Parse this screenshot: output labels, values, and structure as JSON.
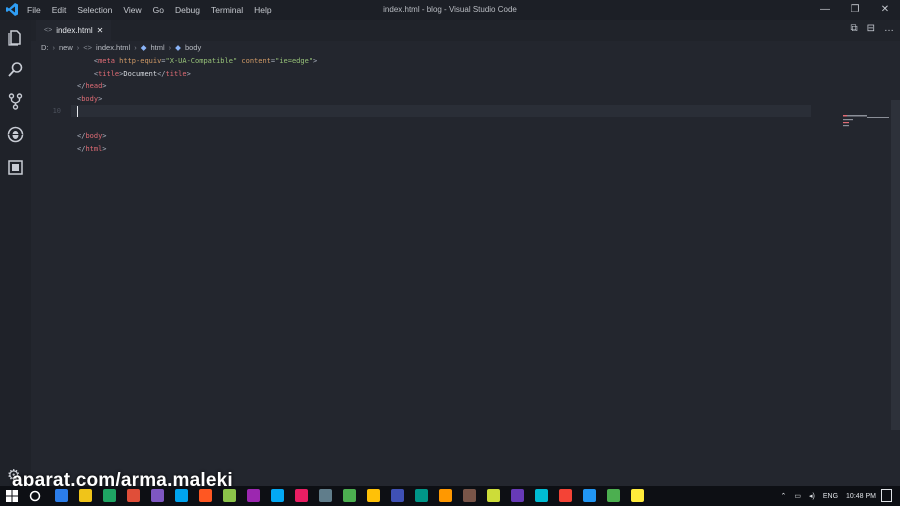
{
  "window": {
    "title": "index.html - blog - Visual Studio Code",
    "controls": [
      "—",
      "❐",
      "✕"
    ]
  },
  "menu": [
    "File",
    "Edit",
    "Selection",
    "View",
    "Go",
    "Debug",
    "Terminal",
    "Help"
  ],
  "activity_bar": [
    "files-icon",
    "search-icon",
    "source-control-icon",
    "debug-icon",
    "extensions-icon"
  ],
  "tab": {
    "label": "index.html",
    "close": "✕"
  },
  "tab_actions": [
    "⧉",
    "⊟",
    "…"
  ],
  "breadcrumb": [
    "D:",
    "new",
    "index.html",
    "html",
    "body"
  ],
  "editor": {
    "lines": [
      {
        "num": "",
        "indent": "    ",
        "tokens": [
          [
            "punct",
            "<"
          ],
          [
            "tag",
            "meta"
          ],
          [
            "attr",
            " http-equiv"
          ],
          [
            "punct",
            "="
          ],
          [
            "str",
            "\"X-UA-Compatible\""
          ],
          [
            "attr",
            " content"
          ],
          [
            "punct",
            "="
          ],
          [
            "str",
            "\"ie=edge\""
          ],
          [
            "punct",
            ">"
          ]
        ]
      },
      {
        "num": "",
        "indent": "    ",
        "tokens": [
          [
            "punct",
            "<"
          ],
          [
            "tag",
            "title"
          ],
          [
            "punct",
            ">"
          ],
          [
            "txt",
            "Document"
          ],
          [
            "punct",
            "</"
          ],
          [
            "tag",
            "title"
          ],
          [
            "punct",
            ">"
          ]
        ]
      },
      {
        "num": "",
        "indent": "",
        "tokens": [
          [
            "punct",
            "</"
          ],
          [
            "tag",
            "head"
          ],
          [
            "punct",
            ">"
          ]
        ]
      },
      {
        "num": "",
        "indent": "",
        "tokens": [
          [
            "punct",
            "<"
          ],
          [
            "tag",
            "body"
          ],
          [
            "punct",
            ">"
          ]
        ]
      },
      {
        "num": "10",
        "indent": "",
        "tokens": []
      },
      {
        "num": "",
        "indent": "",
        "tokens": []
      },
      {
        "num": "",
        "indent": "",
        "tokens": [
          [
            "punct",
            "</"
          ],
          [
            "tag",
            "body"
          ],
          [
            "punct",
            ">"
          ]
        ]
      },
      {
        "num": "",
        "indent": "",
        "tokens": [
          [
            "punct",
            "</"
          ],
          [
            "tag",
            "html"
          ],
          [
            "punct",
            ">"
          ]
        ]
      }
    ]
  },
  "watermark": "aparat.com/arma.maleki",
  "taskbar": {
    "lang": "ENG",
    "time": "10:48 PM",
    "colors": [
      "#2b7de9",
      "#f0c419",
      "#1fa463",
      "#e04e39",
      "#7e57c2",
      "#00a4ef",
      "#ff5722",
      "#8bc34a",
      "#9c27b0",
      "#03a9f4",
      "#e91e63",
      "#607d8b",
      "#4caf50",
      "#ffc107",
      "#3f51b5",
      "#009688",
      "#ff9800",
      "#795548",
      "#cddc39",
      "#673ab7",
      "#00bcd4",
      "#f44336",
      "#2196f3",
      "#4caf50",
      "#ffeb3b"
    ]
  },
  "colors": {
    "editor_bg": "#23262e",
    "tag": "#e06c75",
    "attr": "#d19a66",
    "string": "#98c379"
  }
}
